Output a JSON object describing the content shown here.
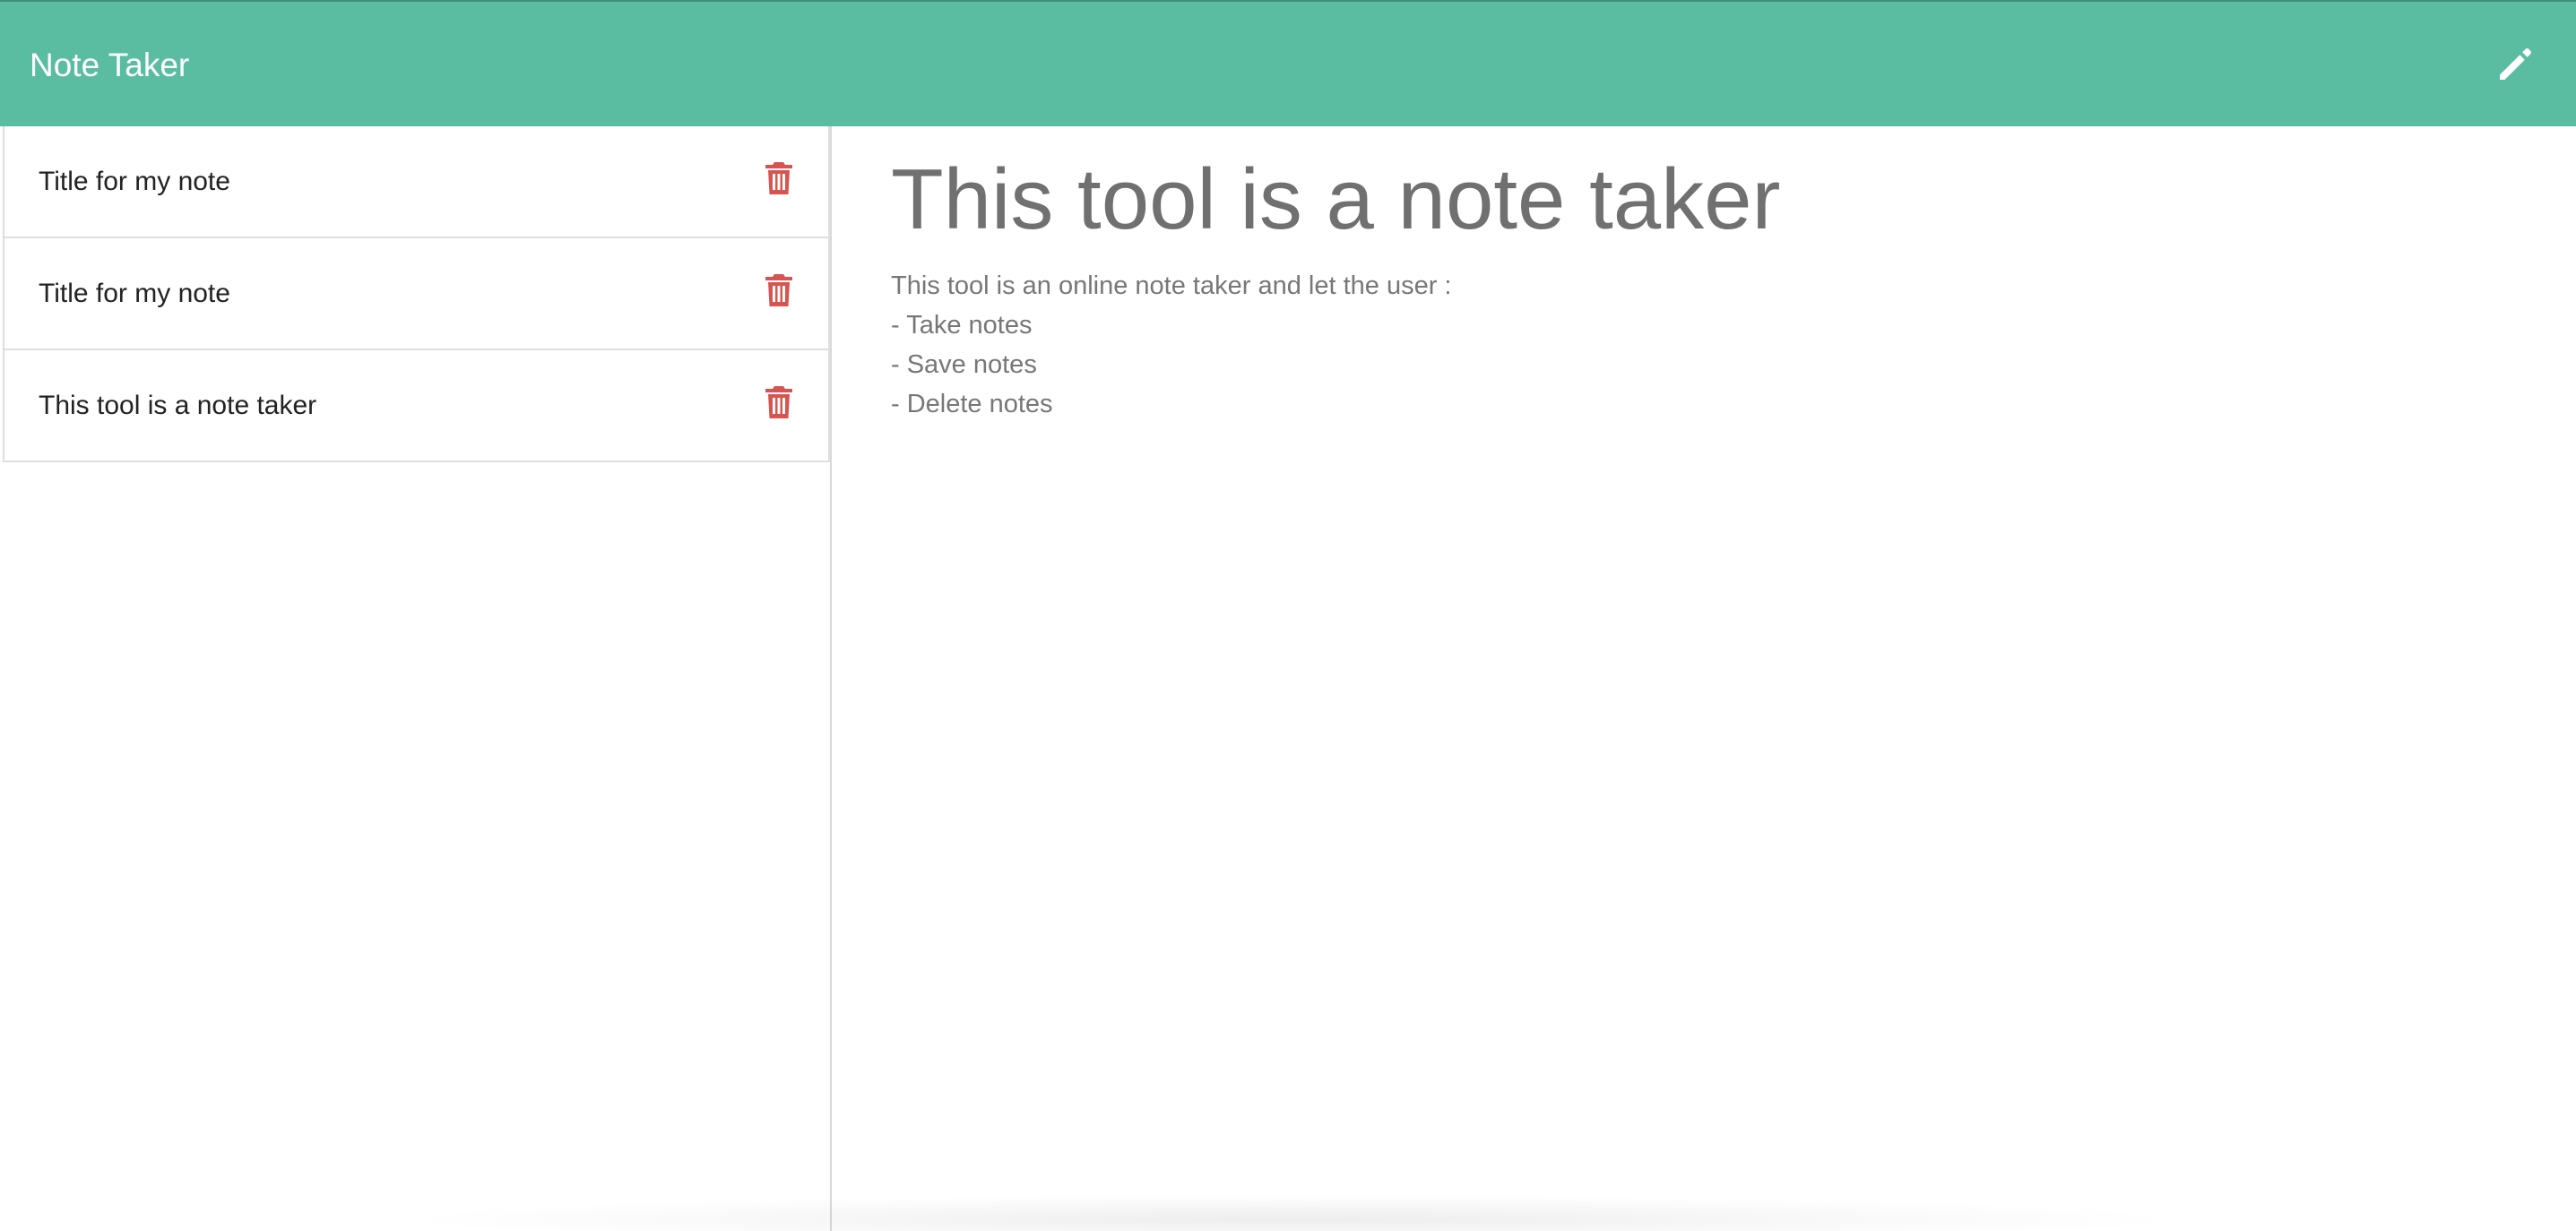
{
  "navbar": {
    "brand": "Note Taker",
    "new_note_icon": "pencil-icon",
    "background_color": "#5abca1"
  },
  "sidebar": {
    "notes": [
      {
        "title": "Title for my note",
        "delete_icon": "trash-icon"
      },
      {
        "title": "Title for my note",
        "delete_icon": "trash-icon"
      },
      {
        "title": "This tool is a note taker",
        "delete_icon": "trash-icon"
      }
    ]
  },
  "note": {
    "title": "This tool is a note taker",
    "body": "This tool is an online note taker and let the user :\n- Take notes\n- Save notes\n- Delete notes"
  },
  "colors": {
    "delete": "#d9534f",
    "heading_text": "#707070",
    "body_text": "#777777"
  }
}
